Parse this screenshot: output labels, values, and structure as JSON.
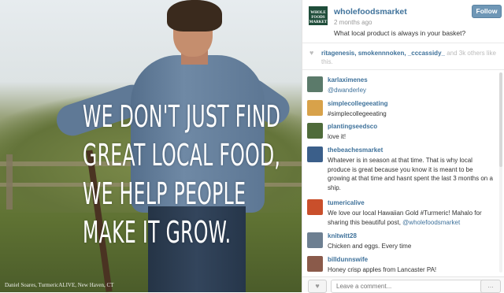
{
  "photo": {
    "overlay_lines": [
      "WE DON'T JUST FIND",
      "GREAT LOCAL FOOD,",
      "WE HELP PEOPLE",
      "MAKE IT GROW."
    ],
    "credit": "Daniel Soares, TurmericALIVE, New Haven, CT"
  },
  "post": {
    "logo_text": "WHOLE FOODS MARKET",
    "username": "wholefoodsmarket",
    "time_ago": "2 months ago",
    "caption": "What local product is always in your basket?",
    "follow_label": "Follow"
  },
  "likes": {
    "names": "ritagenesis, smokennnoken, _cccassidy_",
    "rest": " and 3k others like this.",
    "icon": "heart-icon"
  },
  "comments": [
    {
      "user": "karlaximenes",
      "text": "@dwanderley",
      "avatar_color": "#5b7a6a"
    },
    {
      "user": "simplecollegeeating",
      "text": "#simplecollegeeating",
      "avatar_color": "#d8a24a"
    },
    {
      "user": "plantingseedsco",
      "text": "love it!",
      "avatar_color": "#4f6b3a"
    },
    {
      "user": "thebeachesmarket",
      "text": "Whatever is in season at that time. That is why local produce is great because you know it is meant to be growing at that time and hasnt spent the last 3 months on a ship.",
      "avatar_color": "#3b5f8a"
    },
    {
      "user": "tumericalive",
      "text_before": "We love our local Hawaiian Gold #Turmeric! Mahalo for sharing this beautiful post, ",
      "mention": "@wholefoodsmarket",
      "avatar_color": "#c94f2b"
    },
    {
      "user": "knitwitt28",
      "text": "Chicken and eggs. Every time",
      "avatar_color": "#6d7f91"
    },
    {
      "user": "billdunnswife",
      "text": "Honey crisp apples from Lancaster PA!",
      "avatar_color": "#8a5a4a"
    }
  ],
  "footer": {
    "comment_placeholder": "Leave a comment...",
    "like_icon": "heart-icon",
    "more_label": "..."
  }
}
